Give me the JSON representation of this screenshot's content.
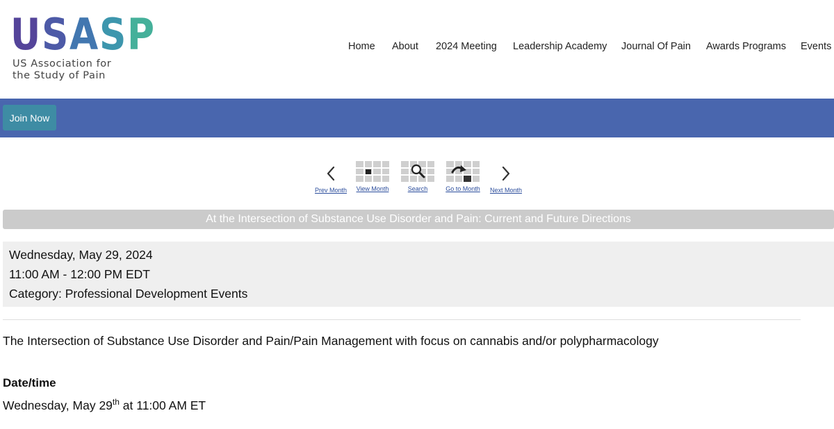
{
  "logo": {
    "letters": [
      "U",
      "S",
      "A",
      "S",
      "P"
    ],
    "colors": [
      "#54449a",
      "#4d5aa7",
      "#4277b0",
      "#3d96ad",
      "#45b09a"
    ],
    "line1": "US Association for",
    "line2": "the Study of Pain"
  },
  "nav": {
    "items": [
      "Home",
      "About",
      "2024 Meeting",
      "Leadership Academy",
      "Journal Of Pain",
      "Awards Programs",
      "Events"
    ]
  },
  "join_label": "Join Now",
  "calnav": {
    "prev": "Prev Month",
    "view": "View Month",
    "search": "Search",
    "goto": "Go to Month",
    "next": "Next Month"
  },
  "event": {
    "title": "At the Intersection of Substance Use Disorder and Pain: Current and Future Directions",
    "date": "Wednesday, May 29, 2024",
    "time": "11:00 AM - 12:00 PM EDT",
    "category": "Category: Professional Development Events",
    "description": "The Intersection of Substance Use Disorder and Pain/Pain Management with focus on cannabis and/or polypharmacology",
    "datetime_label": "Date/time",
    "datetime_main": "Wednesday, May 29",
    "datetime_sup": "th",
    "datetime_rest": " at 11:00 AM ET"
  },
  "colors": {
    "bluebar": "#4966ae",
    "join_button": "#3e8ca4",
    "title_bar": "#cbcbcb",
    "info_box": "#efefef",
    "link": "#2b4d9c"
  }
}
